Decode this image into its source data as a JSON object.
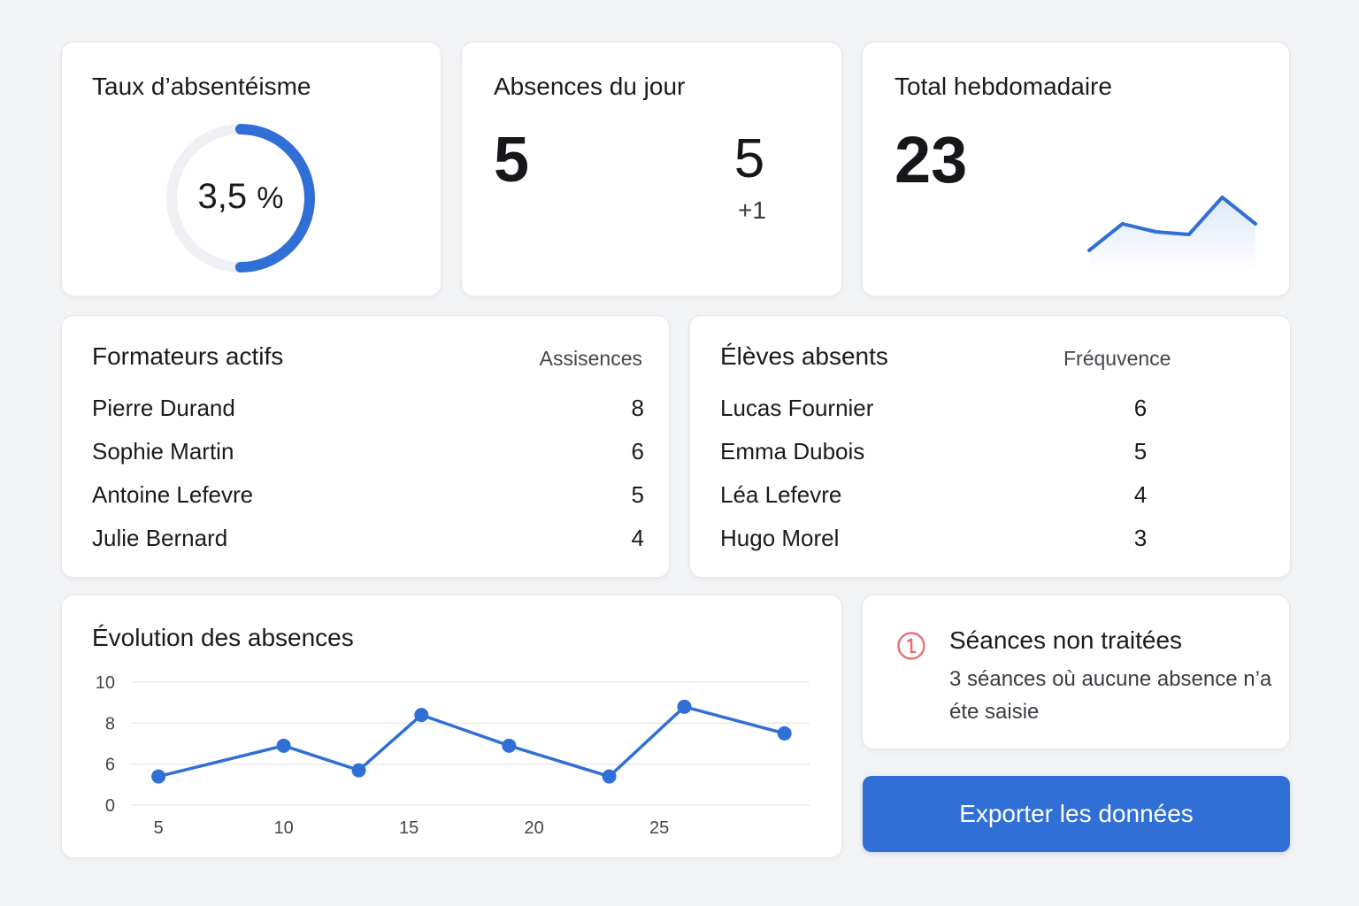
{
  "colors": {
    "accent": "#2f6fd6",
    "ring_track": "#eef0f3",
    "alert": "#e8727a"
  },
  "rate_card": {
    "title": "Taux d’absentéisme",
    "value": "3,5",
    "unit": "%",
    "progress_percent": 50
  },
  "day_card": {
    "title": "Absences du jour",
    "main_value": "5",
    "secondary_value": "5",
    "delta": "+1"
  },
  "week_card": {
    "title": "Total hebdomadaire",
    "total": "23",
    "sparkline": [
      3,
      5,
      4.4,
      4.2,
      7,
      5
    ]
  },
  "trainers": {
    "title": "Formateurs actifs",
    "column_label": "Assisences",
    "rows": [
      {
        "name": "Pierre Durand",
        "value": "8"
      },
      {
        "name": "Sophie Martin",
        "value": "6"
      },
      {
        "name": "Antoine Lefevre",
        "value": "5"
      },
      {
        "name": "Julie Bernard",
        "value": "4"
      }
    ]
  },
  "students": {
    "title": "Élèves absents",
    "column_label": "Fréquvence",
    "rows": [
      {
        "name": "Lucas Fournier",
        "value": "6"
      },
      {
        "name": "Emma Dubois",
        "value": "5"
      },
      {
        "name": "Léa Lefevre",
        "value": "4"
      },
      {
        "name": "Hugo Morel",
        "value": "3"
      }
    ]
  },
  "evolution": {
    "title": "Évolution des absences"
  },
  "chart_data": {
    "type": "line",
    "title": "Évolution des absences",
    "xlabel": "",
    "ylabel": "",
    "y_ticks": [
      "10",
      "8",
      "6",
      "0"
    ],
    "y_tick_values": [
      10,
      8,
      6,
      4
    ],
    "x_ticks": [
      "5",
      "10",
      "15",
      "20",
      "25"
    ],
    "x_tick_values": [
      5,
      10,
      15,
      20,
      25
    ],
    "ylim": [
      4,
      10
    ],
    "grid": true,
    "series": [
      {
        "points": [
          {
            "x": 5,
            "y": 5.4
          },
          {
            "x": 10,
            "y": 6.9
          },
          {
            "x": 13,
            "y": 5.7
          },
          {
            "x": 15.5,
            "y": 8.4
          },
          {
            "x": 19,
            "y": 6.9
          },
          {
            "x": 23,
            "y": 5.4
          },
          {
            "x": 26,
            "y": 8.8
          },
          {
            "x": 30,
            "y": 7.5
          }
        ]
      }
    ]
  },
  "alert": {
    "icon": "alert-circle-icon",
    "title": "Séances non traitées",
    "message": "3 séances où aucune absence n’a éte saisie"
  },
  "export_button": {
    "label": "Exporter les données"
  }
}
